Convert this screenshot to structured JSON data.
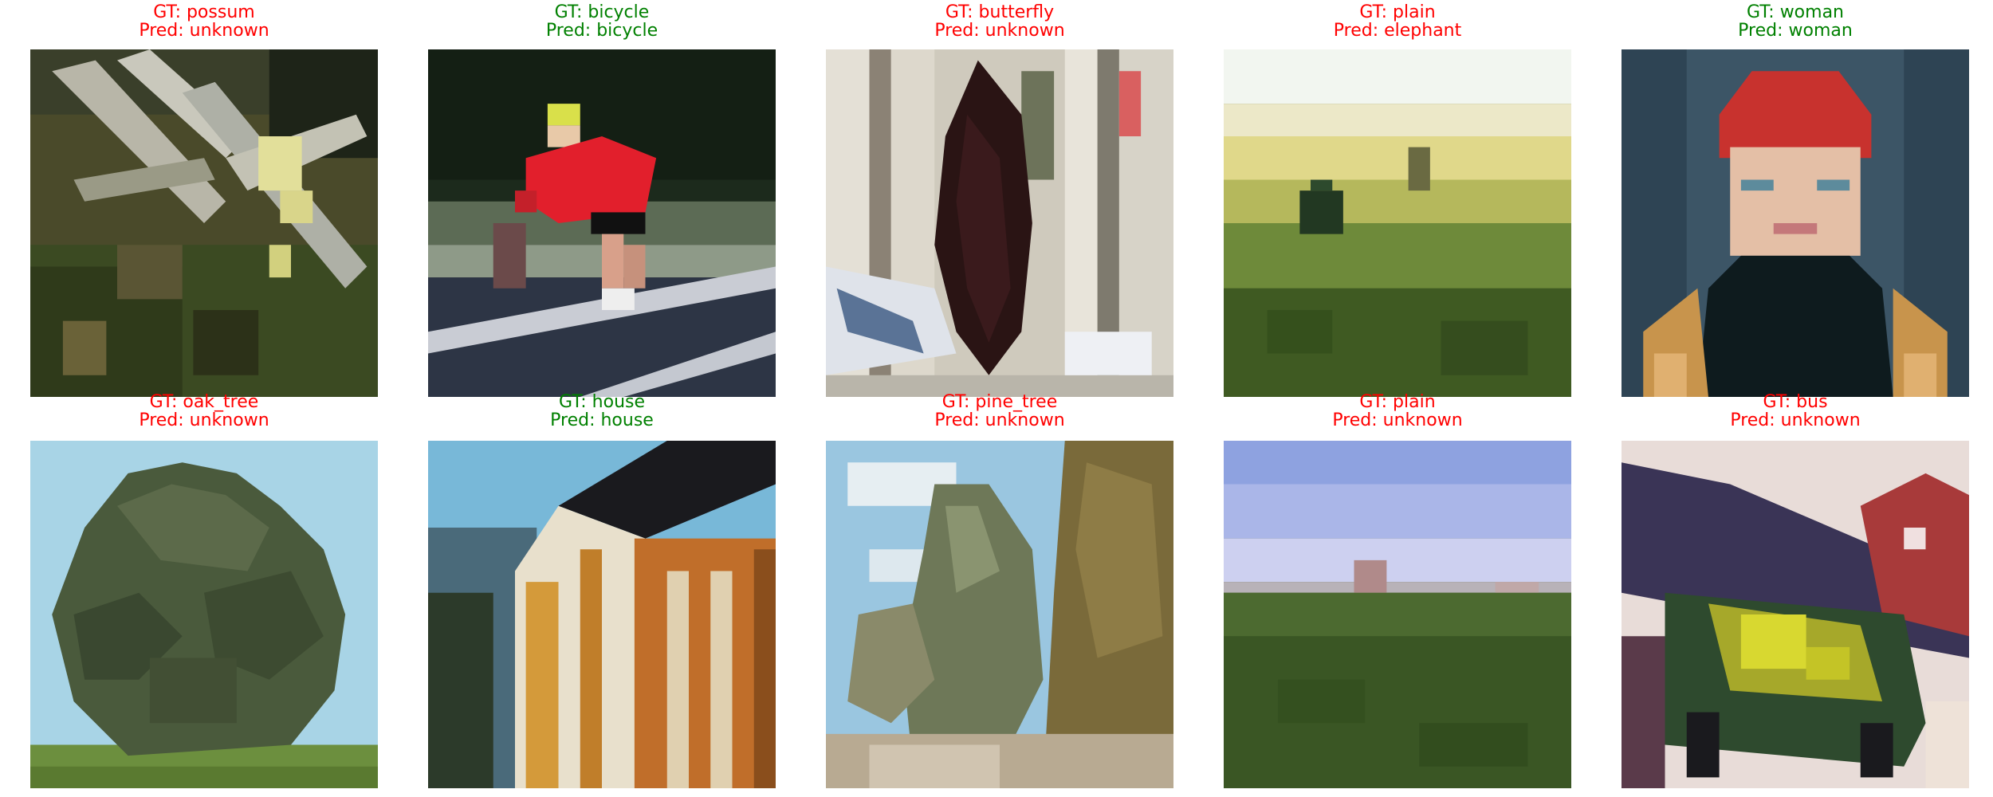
{
  "samples": [
    {
      "gt": "GT: possum",
      "pred": "Pred: unknown",
      "correct": false,
      "image": "forest-branches-closeup"
    },
    {
      "gt": "GT: bicycle",
      "pred": "Pred: bicycle",
      "correct": true,
      "image": "cyclist-on-road"
    },
    {
      "gt": "GT: butterfly",
      "pred": "Pred: unknown",
      "correct": false,
      "image": "dark-wing-between-birch-trunks"
    },
    {
      "gt": "GT: plain",
      "pred": "Pred: elephant",
      "correct": false,
      "image": "yellow-grass-field-horizon"
    },
    {
      "gt": "GT: woman",
      "pred": "Pred: woman",
      "correct": true,
      "image": "woman-red-hat-portrait"
    },
    {
      "gt": "GT: oak_tree",
      "pred": "Pred: unknown",
      "correct": false,
      "image": "round-oak-tree-blue-sky"
    },
    {
      "gt": "GT: house",
      "pred": "Pred: house",
      "correct": true,
      "image": "orange-wooden-house"
    },
    {
      "gt": "GT: pine_tree",
      "pred": "Pred: unknown",
      "correct": false,
      "image": "pine-trees-cloudy-sky"
    },
    {
      "gt": "GT: plain",
      "pred": "Pred: unknown",
      "correct": false,
      "image": "green-field-blue-sky"
    },
    {
      "gt": "GT: bus",
      "pred": "Pred: unknown",
      "correct": false,
      "image": "painted-bus-red-barn"
    }
  ],
  "colors": {
    "correct": "#008000",
    "incorrect": "#ff0000"
  }
}
